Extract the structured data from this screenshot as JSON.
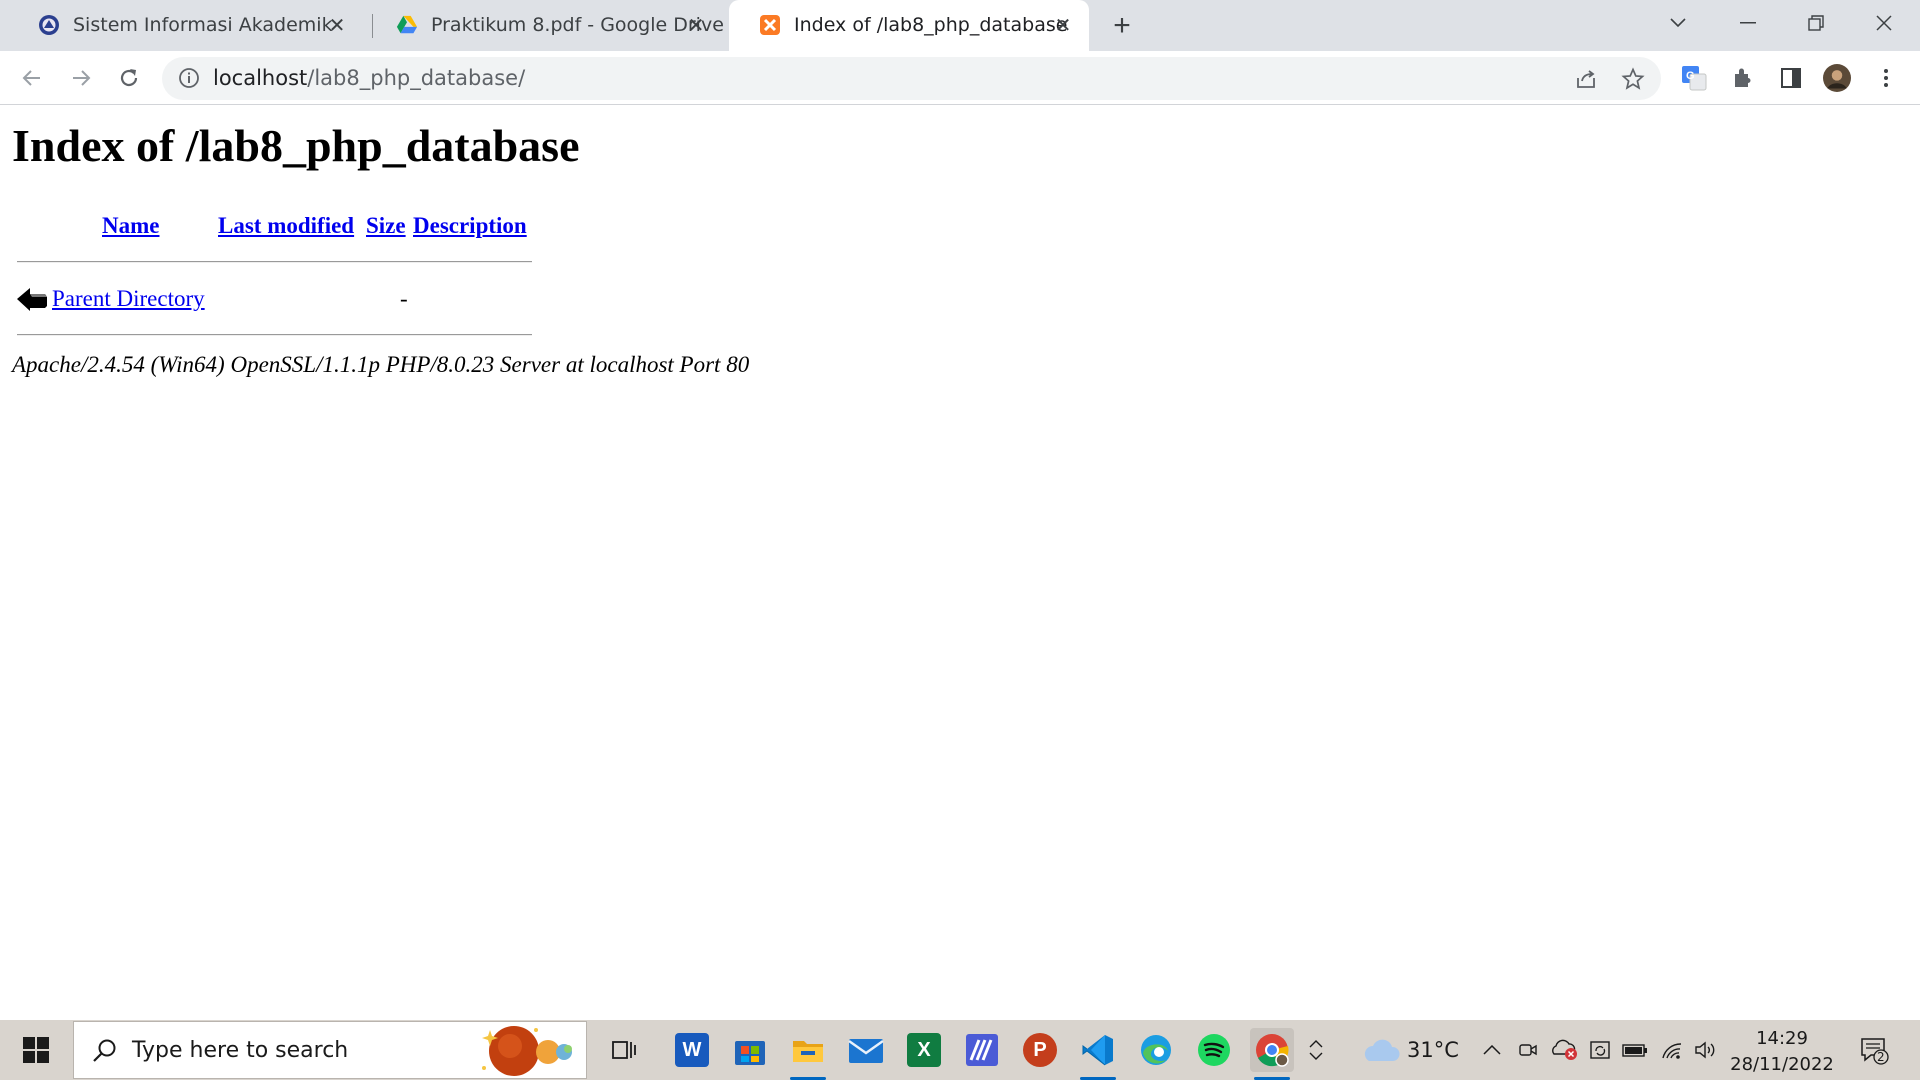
{
  "browser": {
    "tabs": [
      {
        "title": "Sistem Informasi Akademik",
        "icon": "university-emblem-icon"
      },
      {
        "title": "Praktikum 8.pdf - Google Drive",
        "icon": "google-drive-icon"
      },
      {
        "title": "Index of /lab8_php_database",
        "icon": "xampp-icon",
        "active": true
      }
    ],
    "address": {
      "host": "localhost",
      "path": "/lab8_php_database/"
    }
  },
  "page": {
    "heading": "Index of /lab8_php_database",
    "columns": {
      "name": "Name",
      "last_modified": "Last modified",
      "size": "Size",
      "description": "Description"
    },
    "rows": [
      {
        "name": "Parent Directory",
        "last_modified": "",
        "size": "-",
        "description": "",
        "icon": "back-arrow-icon"
      }
    ],
    "address_line": "Apache/2.4.54 (Win64) OpenSSL/1.1.1p PHP/8.0.23 Server at localhost Port 80"
  },
  "taskbar": {
    "search_placeholder": "Type here to search",
    "weather": "31°C",
    "time": "14:29",
    "date": "28/11/2022",
    "notification_count": "2",
    "apps": [
      "task-view",
      "word",
      "microsoft-store",
      "file-explorer",
      "mail",
      "excel",
      "vpn-app",
      "powerpoint",
      "vscode",
      "edge",
      "spotify",
      "chrome"
    ]
  },
  "colors": {
    "link": "#0000ee",
    "tabstrip": "#dee1e6",
    "taskbar": "#d9d4ce"
  }
}
